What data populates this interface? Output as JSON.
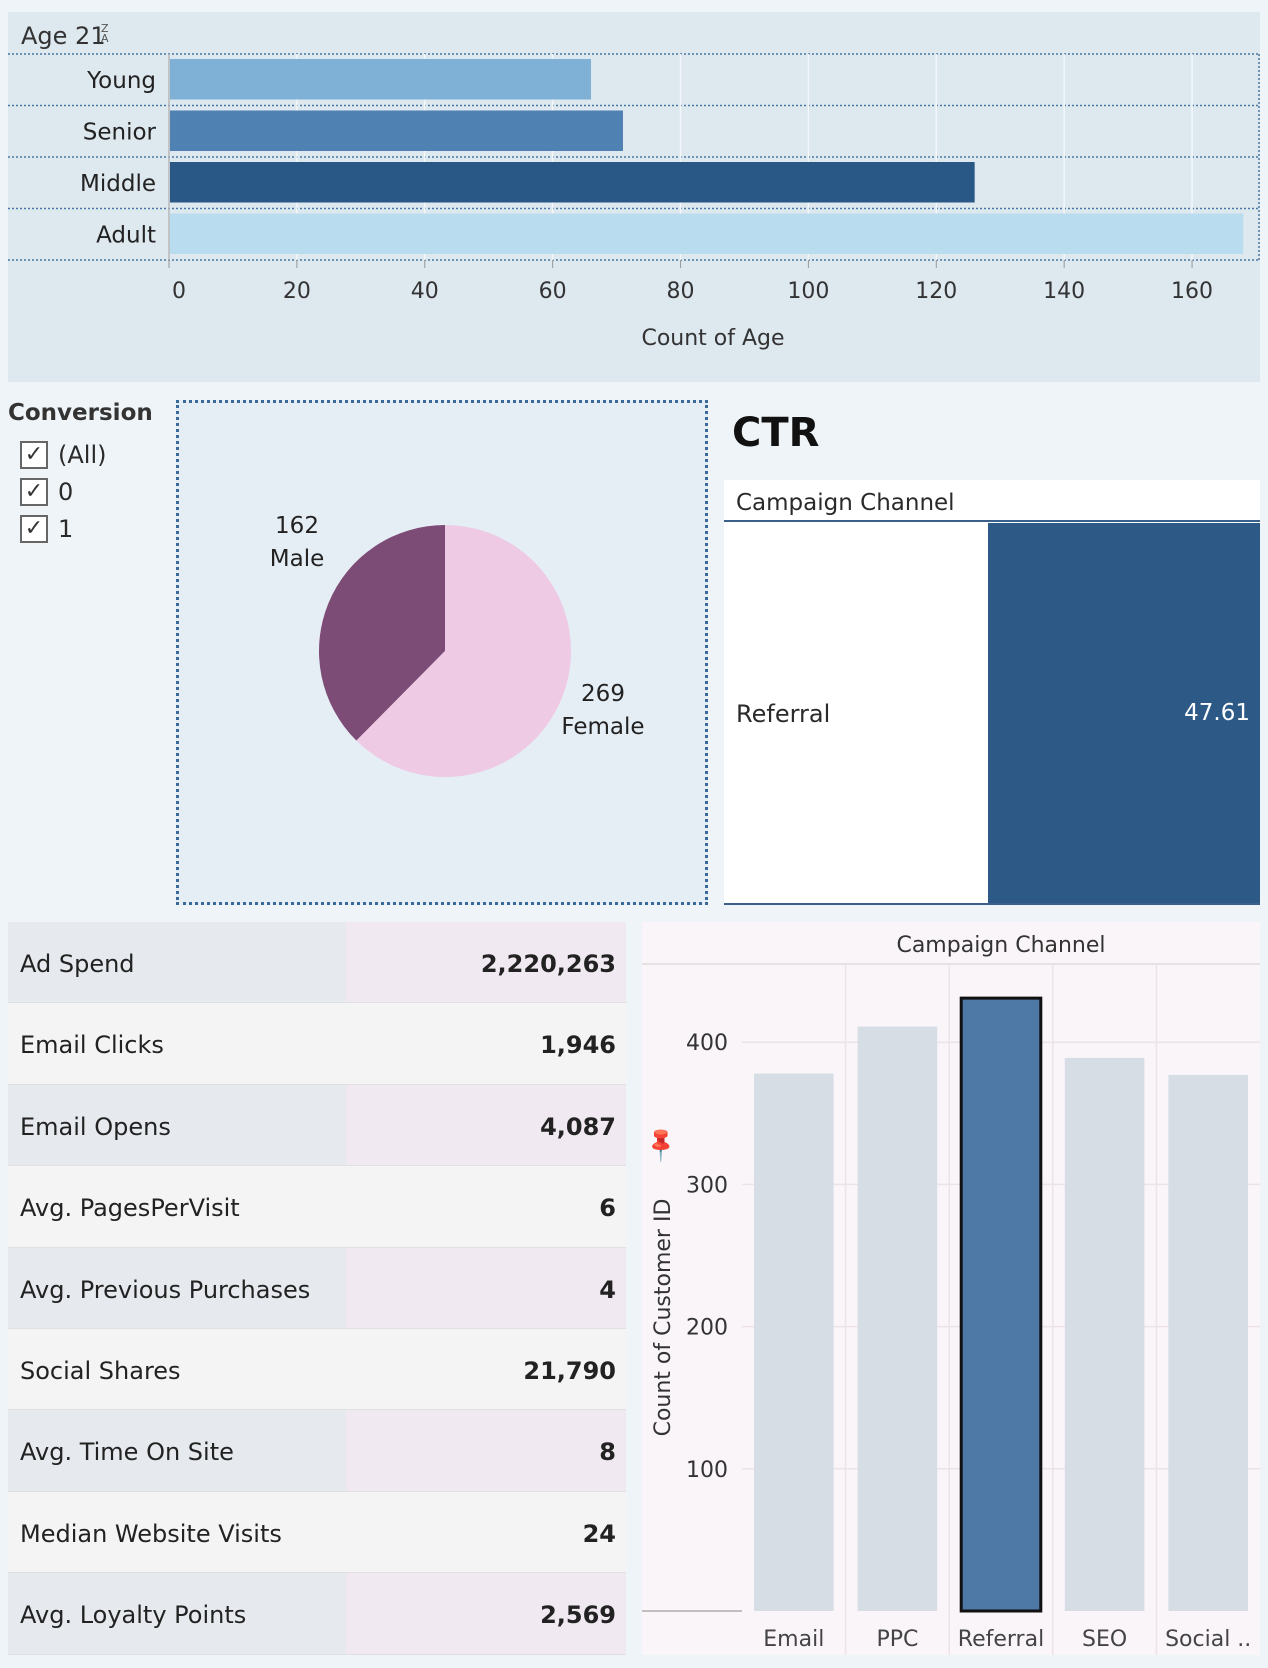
{
  "age_panel": {
    "field_title": "Age 21",
    "sort_icon": "sort-z-a-icon",
    "chart_data": {
      "type": "bar",
      "orientation": "horizontal",
      "categories": [
        "Young",
        "Senior",
        "Middle",
        "Adult"
      ],
      "values": [
        66,
        71,
        126,
        168
      ],
      "colors": [
        "#7fb0d6",
        "#4f81b2",
        "#2a5886",
        "#b9dcee"
      ],
      "xlabel": "Count of Age",
      "xticks": [
        "0",
        "20",
        "40",
        "60",
        "80",
        "100",
        "120",
        "140",
        "160"
      ],
      "xlim": [
        0,
        170
      ],
      "grid": true
    }
  },
  "conversion_filter": {
    "title": "Conversion",
    "options": [
      {
        "label": "(All)",
        "checked": true
      },
      {
        "label": "0",
        "checked": true
      },
      {
        "label": "1",
        "checked": true
      }
    ],
    "check_glyph": "✓"
  },
  "gender_pie": {
    "chart_data": {
      "type": "pie",
      "slices": [
        {
          "label": "Male",
          "value": 162,
          "color": "#7d4c76"
        },
        {
          "label": "Female",
          "value": 269,
          "color": "#eecae4"
        }
      ]
    }
  },
  "ctr": {
    "title": "CTR",
    "header": "Campaign Channel",
    "row_label": "Referral",
    "value": "47.61",
    "bar_color": "#2d5986"
  },
  "metrics": [
    {
      "label": "Ad Spend",
      "value": "2,220,263"
    },
    {
      "label": "Email Clicks",
      "value": "1,946"
    },
    {
      "label": "Email Opens",
      "value": "4,087"
    },
    {
      "label": "Avg. PagesPerVisit",
      "value": "6"
    },
    {
      "label": "Avg. Previous Purchases",
      "value": "4"
    },
    {
      "label": "Social Shares",
      "value": "21,790"
    },
    {
      "label": "Avg. Time On Site",
      "value": "8"
    },
    {
      "label": "Median Website Visits",
      "value": "24"
    },
    {
      "label": "Avg. Loyalty Points",
      "value": "2,569"
    }
  ],
  "channel_chart": {
    "pin_icon": "pin-icon",
    "chart_data": {
      "type": "bar",
      "title": "Campaign Channel",
      "categories": [
        "Email",
        "PPC",
        "Referral",
        "SEO",
        "Social .."
      ],
      "values": [
        378,
        411,
        431,
        389,
        377
      ],
      "selected": "Referral",
      "ylabel": "Count of Customer ID",
      "yticks": [
        "100",
        "200",
        "300",
        "400"
      ],
      "ylim": [
        0,
        455
      ],
      "bar_color": "#d6dde5",
      "selected_color": "#4e79a7"
    }
  }
}
